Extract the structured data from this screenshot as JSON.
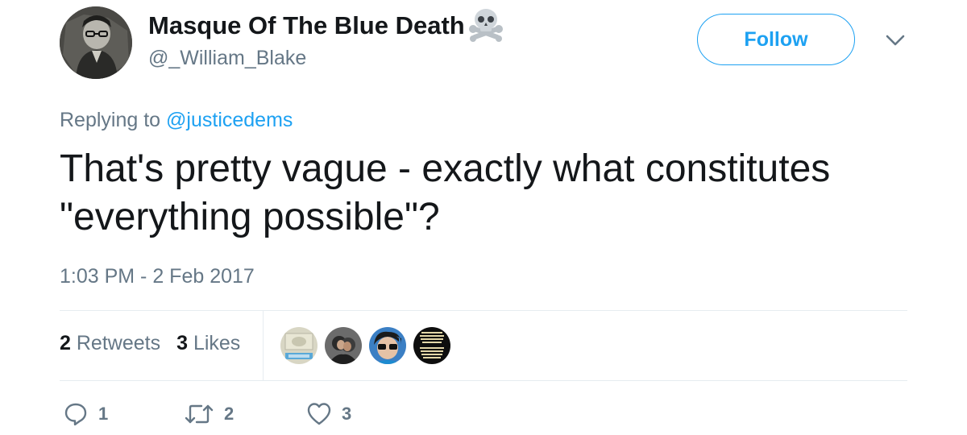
{
  "user": {
    "display_name": "Masque Of The Blue Death",
    "screen_name": "@_William_Blake"
  },
  "header": {
    "follow_label": "Follow"
  },
  "reply": {
    "prefix": "Replying to",
    "handle": "@justicedems"
  },
  "tweet": {
    "text": "That's pretty vague - exactly what constitutes\n\"everything possible\"?",
    "timestamp": "1:03 PM - 2 Feb 2017"
  },
  "stats": {
    "retweets_count": "2",
    "retweets_label": "Retweets",
    "likes_count": "3",
    "likes_label": "Likes"
  },
  "actions": {
    "reply_count": "1",
    "retweet_count": "2",
    "like_count": "3"
  },
  "colors": {
    "accent": "#1da1f2",
    "muted": "#657786",
    "text": "#14171a",
    "divider": "#e6ecf0"
  },
  "icons": [
    "skull-and-crossbones-icon",
    "chevron-down-icon",
    "reply-icon",
    "retweet-icon",
    "heart-icon"
  ]
}
